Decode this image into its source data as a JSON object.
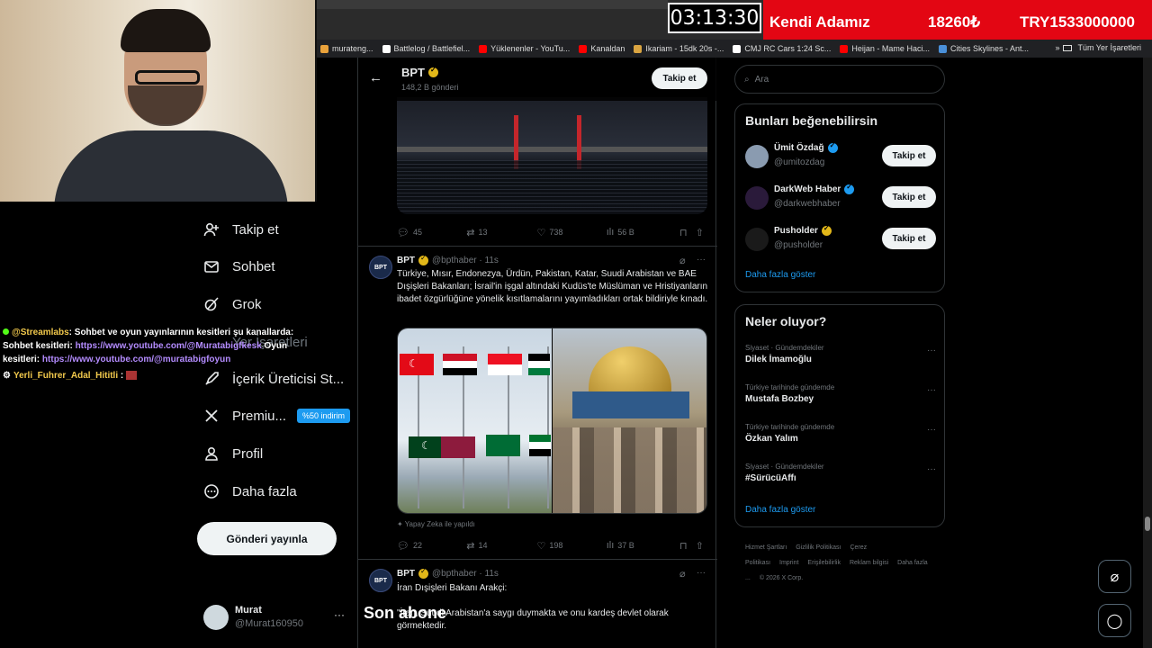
{
  "stream": {
    "timer": "03:13:30",
    "banner_name": "Kendi Adamız",
    "banner_amount": "18260₺",
    "banner_total": "TRY1533000000",
    "son_abone": "Son abone"
  },
  "bookmarks": [
    {
      "label": "murateng...",
      "color": "#e9a23b"
    },
    {
      "label": "Battlelog / Battlefiel...",
      "color": "#ffffff"
    },
    {
      "label": "Yüklenenler - YouTu...",
      "color": "#ff0000"
    },
    {
      "label": "Kanaldan",
      "color": "#ff0000"
    },
    {
      "label": "Ikariam - 15dk 20s -...",
      "color": "#d9a441"
    },
    {
      "label": "CMJ RC Cars 1:24 Sc...",
      "color": "#ffffff"
    },
    {
      "label": "Heijan - Mame Haci...",
      "color": "#ff0000"
    },
    {
      "label": "Cities Skylines - Ant...",
      "color": "#4a90d9"
    }
  ],
  "bookmarks_all": "Tüm Yer İşaretleri",
  "nav": {
    "items": [
      {
        "label": "Takip et",
        "icon": "person-add-icon"
      },
      {
        "label": "Sohbet",
        "icon": "mail-icon"
      },
      {
        "label": "Grok",
        "icon": "grok-icon"
      },
      {
        "label": "Yer İşaretleri",
        "icon": "bookmark-icon"
      },
      {
        "label": "İçerik Üreticisi St...",
        "icon": "rocket-icon"
      },
      {
        "label": "Premiu...",
        "icon": "x-logo-icon",
        "badge": "%50 indirim"
      },
      {
        "label": "Profil",
        "icon": "profile-icon"
      },
      {
        "label": "Daha fazla",
        "icon": "more-circle-icon"
      }
    ],
    "post_button": "Gönderi yayınla",
    "account_name": "Murat",
    "account_handle": "@Murat160950",
    "account_more": "···"
  },
  "chat": {
    "user1": "@Streamlabs",
    "msg1": ": Sohbet ve oyun yayınlarının kesitleri şu kanallarda: Sohbet kesitleri: ",
    "link1": "https://www.youtube.com/@Muratabigfkesk",
    "msg1b": " Oyun kesitleri: ",
    "link2": "https://www.youtube.com/@muratabigfoyun",
    "user2": "Yerli_Fuhrer_Adal_Hititli",
    "msg2": " :"
  },
  "timeline": {
    "name": "BPT",
    "posts_count": "148,2 B gönderi",
    "follow_label": "Takip et",
    "tweet1_actions": {
      "replies": "45",
      "reposts": "13",
      "likes": "738",
      "views": "56 B"
    },
    "tweet2": {
      "name": "BPT",
      "handle": "@bpthaber · 11s",
      "avatar": "BPT",
      "text": "Türkiye, Mısır, Endonezya, Ürdün, Pakistan, Katar, Suudi Arabistan ve BAE Dışişleri Bakanları; İsrail'in işgal altındaki Kudüs'te Müslüman ve Hristiyanların ibadet özgürlüğüne yönelik kısıtlamalarını yayımladıkları ortak bildiriyle kınadı.",
      "ai_note": "Yapay Zeka ile yapıldı",
      "actions": {
        "replies": "22",
        "reposts": "14",
        "likes": "198",
        "views": "37 B"
      }
    },
    "tweet3": {
      "name": "BPT",
      "handle": "@bpthaber · 11s",
      "avatar": "BPT",
      "text1": "İran Dışişleri Bakanı Arakçi:",
      "text2": "\"İran, Suudi Arabistan'a saygı duymakta ve onu kardeş devlet olarak görmektedir."
    }
  },
  "sidebar": {
    "search_placeholder": "Ara",
    "who_title": "Bunları beğenebilirsin",
    "who": [
      {
        "name": "Ümit Özdağ",
        "handle": "@umitozdag",
        "button": "Takip et",
        "verified": "blue",
        "avatar_color": "#8a9bb0"
      },
      {
        "name": "DarkWeb Haber",
        "handle": "@darkwebhaber",
        "button": "Takip et",
        "verified": "blue",
        "avatar_color": "#2a1a3a"
      },
      {
        "name": "Pusholder",
        "handle": "@pusholder",
        "button": "Takip et",
        "verified": "gold",
        "avatar_color": "#1a1a1a"
      }
    ],
    "who_more": "Daha fazla göster",
    "trends_title": "Neler oluyor?",
    "trends": [
      {
        "category": "Siyaset · Gündemdekiler",
        "title": "Dilek İmamoğlu"
      },
      {
        "category": "Türkiye tarihinde gündemde",
        "title": "Mustafa Bozbey"
      },
      {
        "category": "Türkiye tarihinde gündemde",
        "title": "Özkan Yalım"
      },
      {
        "category": "Siyaset · Gündemdekiler",
        "title": "#SürücüAffı"
      }
    ],
    "trends_more": "Daha fazla göster",
    "footer": [
      "Hizmet Şartları",
      "Gizlilik Politikası",
      "Çerez Politikası",
      "Imprint",
      "Erişilebilirlik",
      "Reklam bilgisi",
      "Daha fazla ...",
      "© 2026 X Corp."
    ]
  }
}
